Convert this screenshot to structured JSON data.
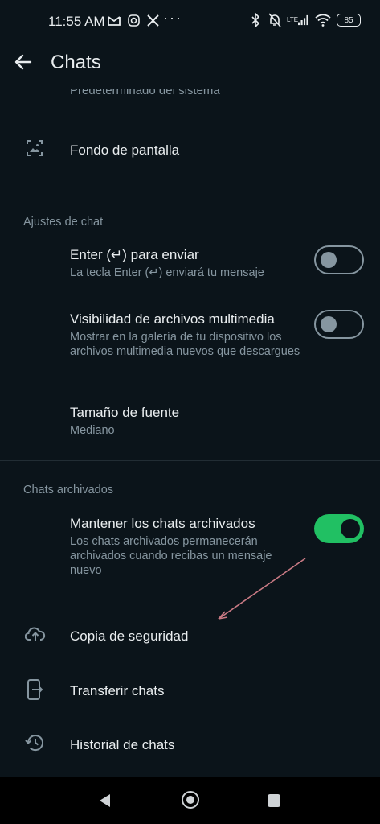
{
  "status_bar": {
    "time": "11:55 AM",
    "network": "LTE",
    "battery": "85",
    "overflow": "···"
  },
  "app_bar": {
    "title": "Chats"
  },
  "partial_row": {
    "subtitle": "Predeterminado del sistema"
  },
  "rows": {
    "wallpaper": {
      "title": "Fondo de pantalla"
    },
    "enter_send": {
      "title": "Enter (↵) para enviar",
      "subtitle": "La tecla Enter (↵) enviará tu mensaje",
      "toggle": "off"
    },
    "media_visibility": {
      "title": "Visibilidad de archivos multimedia",
      "subtitle": "Mostrar en la galería de tu dispositivo los archivos multimedia nuevos que descargues",
      "toggle": "off"
    },
    "font_size": {
      "title": "Tamaño de fuente",
      "subtitle": "Mediano"
    },
    "keep_archived": {
      "title": "Mantener los chats archivados",
      "subtitle": "Los chats archivados permanecerán archivados cuando recibas un mensaje nuevo",
      "toggle": "on"
    },
    "backup": {
      "title": "Copia de seguridad"
    },
    "transfer": {
      "title": "Transferir chats"
    },
    "history": {
      "title": "Historial de chats"
    }
  },
  "sections": {
    "chat_settings": "Ajustes de chat",
    "archived_chats": "Chats archivados"
  },
  "colors": {
    "background": "#0b141a",
    "accent_green": "#21c063",
    "secondary_text": "#8696a0",
    "annotation_arrow": "#c97a84"
  },
  "icons": {
    "back": "arrow-left-icon",
    "wallpaper": "wallpaper-icon",
    "backup": "cloud-upload-icon",
    "transfer": "phone-transfer-icon",
    "history": "history-icon"
  }
}
